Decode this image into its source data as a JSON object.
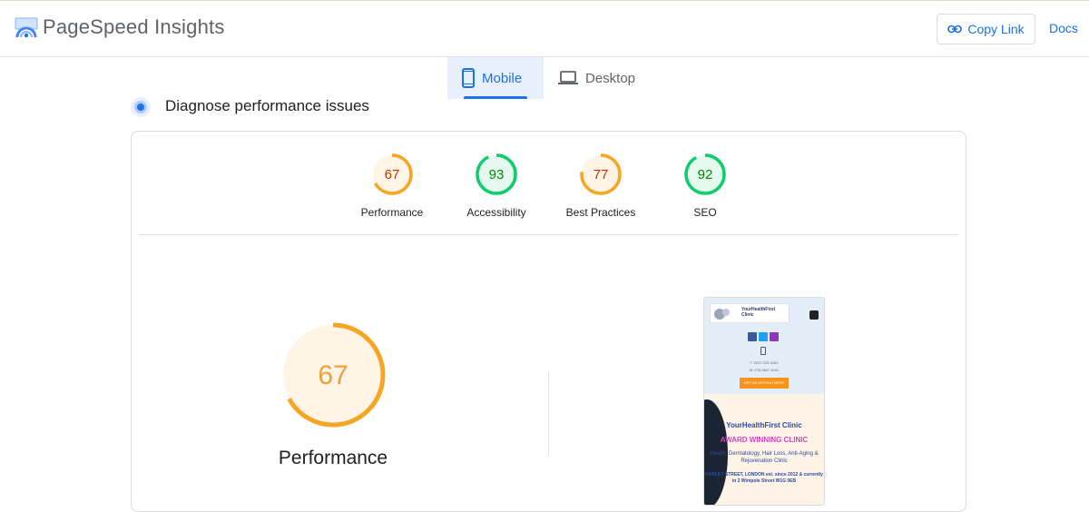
{
  "header": {
    "brand": "PageSpeed Insights",
    "copy_link_label": "Copy Link",
    "docs_label": "Docs"
  },
  "tabs": [
    {
      "label": "Mobile",
      "icon": "smartphone-icon",
      "active": true
    },
    {
      "label": "Desktop",
      "icon": "laptop-icon",
      "active": false
    }
  ],
  "section": {
    "title": "Diagnose performance issues"
  },
  "scores": [
    {
      "label": "Performance",
      "value": "67",
      "level": 0.67,
      "color": "#f5a623"
    },
    {
      "label": "Accessibility",
      "value": "93",
      "level": 0.93,
      "color": "#0cce6b"
    },
    {
      "label": "Best Practices",
      "value": "77",
      "level": 0.77,
      "color": "#f5a623"
    },
    {
      "label": "SEO",
      "value": "92",
      "level": 0.92,
      "color": "#0cce6b"
    }
  ],
  "main_score": {
    "value": "67",
    "level": 0.67,
    "label": "Performance",
    "color": "#f5a623"
  },
  "screenshot": {
    "site_title": "YourHealthFirst Clinic",
    "tel": "T: 0207 225 3182",
    "mobile": "M: 078 3847 4041",
    "button": "GET AN APPOINTMENT",
    "hero_title": "YourHealthFirst Clinic",
    "hero_award": "AWARD WINNING CLINIC",
    "hero_services": "Health, Dermatology, Hair Loss, Anti-Aging & Rejuvenation Clinic",
    "hero_address": "HARLEY STREET, LONDON est. since 2012 & currently in 2 Wimpole Street W1G 0EB"
  }
}
